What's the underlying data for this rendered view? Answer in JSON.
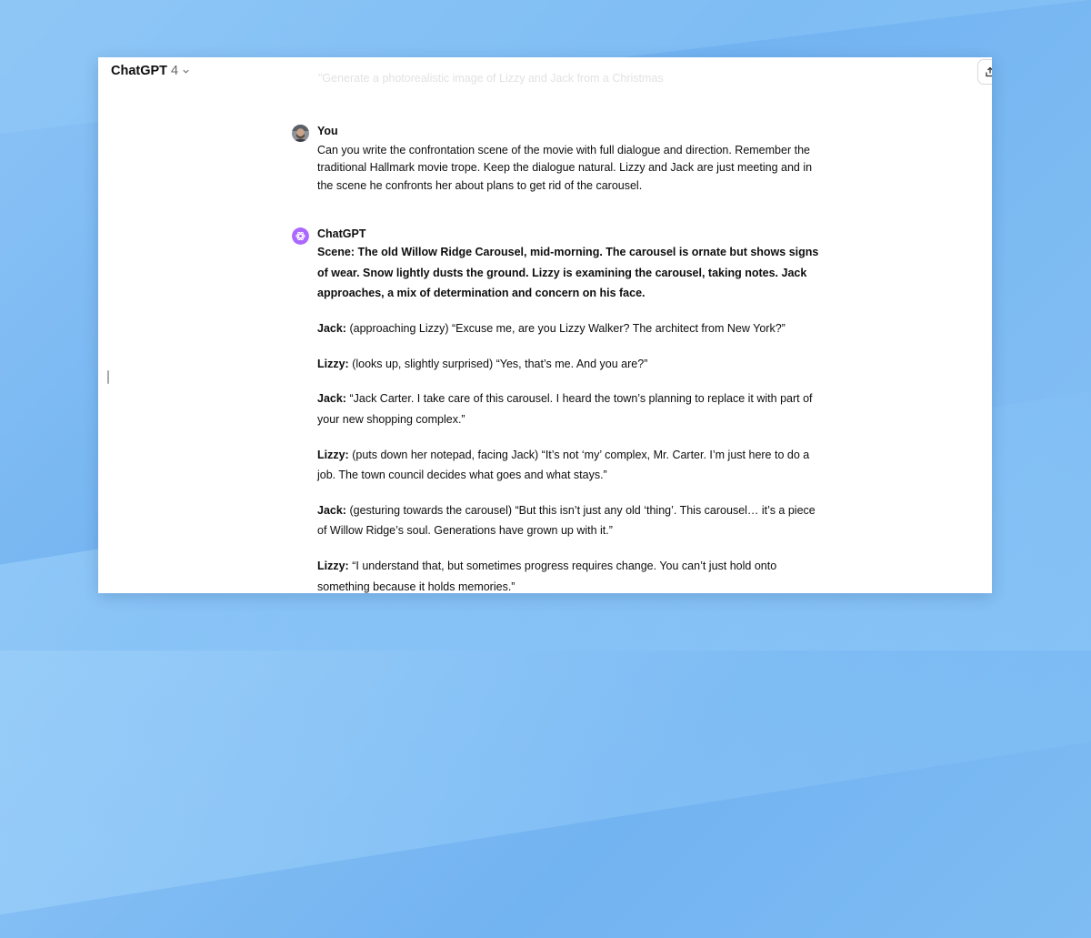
{
  "header": {
    "model_name": "ChatGPT",
    "model_version": "4",
    "faded_title": "\"Generate a photorealistic image of Lizzy and Jack from a Christmas"
  },
  "user_message": {
    "author": "You",
    "text": "Can you write the confrontation scene of the movie with full dialogue and direction. Remember the traditional Hallmark movie trope. Keep the dialogue natural. Lizzy and Jack are just meeting and in the scene he confronts her about plans to get rid of the carousel."
  },
  "assistant_message": {
    "author": "ChatGPT",
    "scene": "Scene: The old Willow Ridge Carousel, mid-morning. The carousel is ornate but shows signs of wear. Snow lightly dusts the ground. Lizzy is examining the carousel, taking notes. Jack approaches, a mix of determination and concern on his face.",
    "lines": [
      {
        "speaker": "Jack:",
        "text": " (approaching Lizzy) “Excuse me, are you Lizzy Walker? The architect from New York?”"
      },
      {
        "speaker": "Lizzy:",
        "text": " (looks up, slightly surprised) “Yes, that’s me. And you are?”"
      },
      {
        "speaker": "Jack:",
        "text": " “Jack Carter. I take care of this carousel. I heard the town’s planning to replace it with part of your new shopping complex.”"
      },
      {
        "speaker": "Lizzy:",
        "text": " (puts down her notepad, facing Jack) “It’s not ‘my’ complex, Mr. Carter. I’m just here to do a job. The town council decides what goes and what stays.”"
      },
      {
        "speaker": "Jack:",
        "text": " (gesturing towards the carousel) “But this isn’t just any old ‘thing’. This carousel… it’s a piece of Willow Ridge’s soul. Generations have grown up with it.”"
      },
      {
        "speaker": "Lizzy:",
        "text": " “I understand that, but sometimes progress requires change. You can’t just hold onto something because it holds memories.”"
      }
    ]
  },
  "icons": {
    "model_chevron": "chevron-down-icon",
    "share": "share-icon",
    "assistant_avatar": "openai-logo-icon"
  },
  "colors": {
    "assistant_avatar_bg": "#ab68ff",
    "text": "#0d0d0d"
  }
}
